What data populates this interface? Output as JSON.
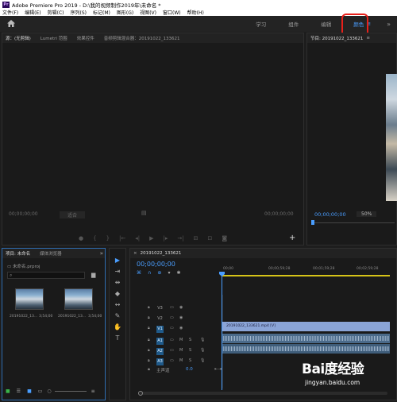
{
  "window": {
    "app_icon": "Pr",
    "title": "Adobe Premiere Pro 2019 - D:\\我的视频制作2019年\\未命名 *"
  },
  "menu": [
    "文件(F)",
    "编辑(E)",
    "剪辑(C)",
    "序列(S)",
    "标记(M)",
    "图形(G)",
    "视图(V)",
    "窗口(W)",
    "帮助(H)"
  ],
  "workspaces": {
    "tabs": [
      "学习",
      "组件",
      "编辑",
      "颜色"
    ],
    "active": "颜色",
    "menu_glyph": "≡",
    "more_glyph": "»"
  },
  "source_panel": {
    "tabs": [
      "源：(无剪辑)",
      "Lumetri 范围",
      "效果控件",
      "音频剪辑混合器：20191022_133621"
    ],
    "timecode_left": "00;00;00;00",
    "fit_label": "适合",
    "timecode_right": "00;00;00;00"
  },
  "program_panel": {
    "tab": "节目: 20191022_133621",
    "menu_glyph": "≡",
    "timecode": "00;00;00;00",
    "zoom": "50%"
  },
  "project_panel": {
    "tabs": [
      "项目: 未命名",
      "媒体浏览器"
    ],
    "file": "未命名.prproj",
    "clips": [
      {
        "name": "20191022_13...",
        "duration": "3;54;00"
      },
      {
        "name": "20191022_13...",
        "duration": "3;54;00"
      }
    ]
  },
  "timeline": {
    "sequence_tab": "20191022_133621",
    "timecode": "00;00;00;00",
    "ruler": [
      "00;00",
      "00;00;59;28",
      "00;01;59;28",
      "00;02;59;28"
    ],
    "video_tracks": [
      "V3",
      "V2",
      "V1"
    ],
    "audio_tracks": [
      "A1",
      "A2",
      "A3"
    ],
    "master_label": "主声道",
    "master_value": "0.0",
    "clip_label": "20191022_133621.mp4 [V]"
  },
  "watermark": {
    "logo": "Bai度经验",
    "url": "jingyan.baidu.com"
  },
  "colors": {
    "accent": "#4a9eff",
    "highlight": "#e8201a",
    "video_clip": "#8aa4d6",
    "audio_clip": "#4a6a8a"
  }
}
